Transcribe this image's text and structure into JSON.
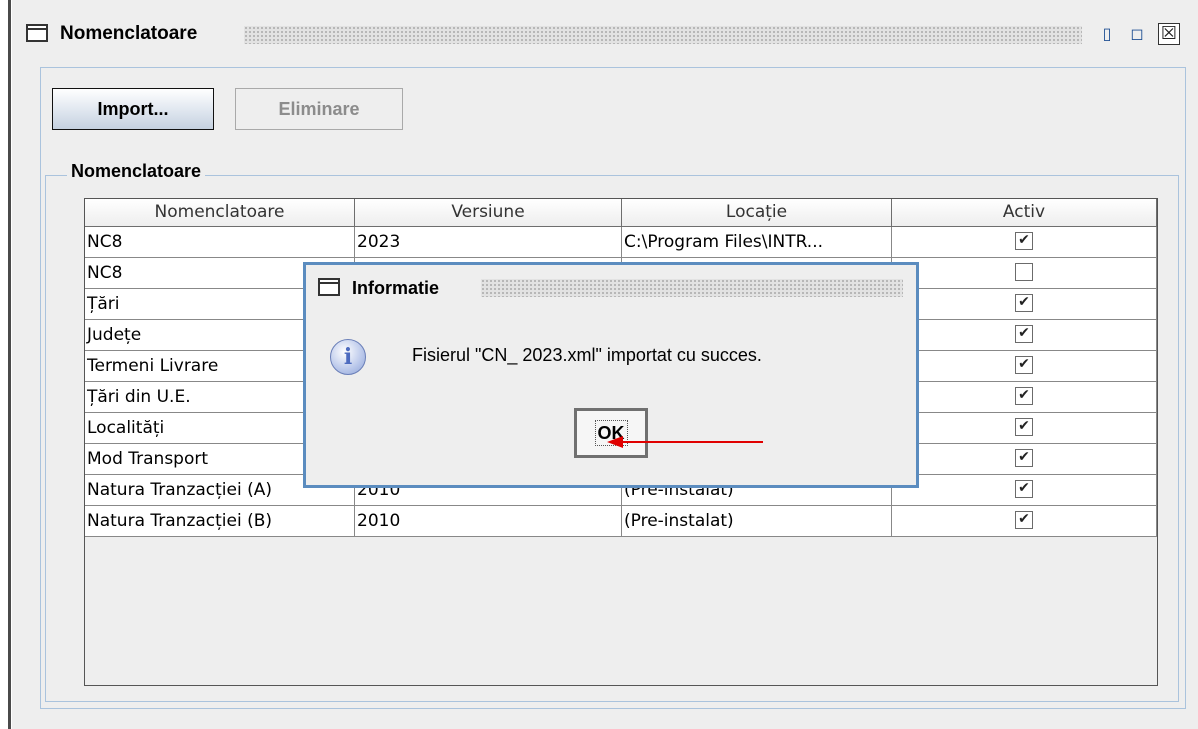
{
  "window": {
    "title": "Nomenclatoare",
    "minimize_icon": "iconify-icon",
    "maximize_icon": "maximize-icon",
    "close_icon": "close-icon"
  },
  "toolbar": {
    "import_label": "Import...",
    "remove_label": "Eliminare"
  },
  "group": {
    "title": "Nomenclatoare"
  },
  "table": {
    "columns": [
      "Nomenclatoare",
      "Versiune",
      "Locație",
      "Activ"
    ],
    "rows": [
      {
        "name": "NC8",
        "version": "2023",
        "location": "C:\\Program Files\\INTR...",
        "active": true
      },
      {
        "name": "NC8",
        "version": "",
        "location": "",
        "active": false
      },
      {
        "name": "Țări",
        "version": "",
        "location": "",
        "active": true
      },
      {
        "name": "Județe",
        "version": "",
        "location": "",
        "active": true
      },
      {
        "name": "Termeni Livrare",
        "version": "",
        "location": "",
        "active": true
      },
      {
        "name": "Țări din U.E.",
        "version": "",
        "location": "",
        "active": true
      },
      {
        "name": "Localități",
        "version": "",
        "location": "",
        "active": true
      },
      {
        "name": "Mod Transport",
        "version": "",
        "location": "",
        "active": true
      },
      {
        "name": "Natura Tranzacției (A)",
        "version": "2010",
        "location": "(Pre-instalat)",
        "active": true
      },
      {
        "name": "Natura Tranzacției (B)",
        "version": "2010",
        "location": "(Pre-instalat)",
        "active": true
      }
    ]
  },
  "dialog": {
    "title": "Informatie",
    "message": "Fisierul \"CN_ 2023.xml\" importat cu succes.",
    "ok_label": "OK",
    "icon": "info-icon",
    "check_mark": "✔",
    "annotation_color": "#e00000"
  }
}
